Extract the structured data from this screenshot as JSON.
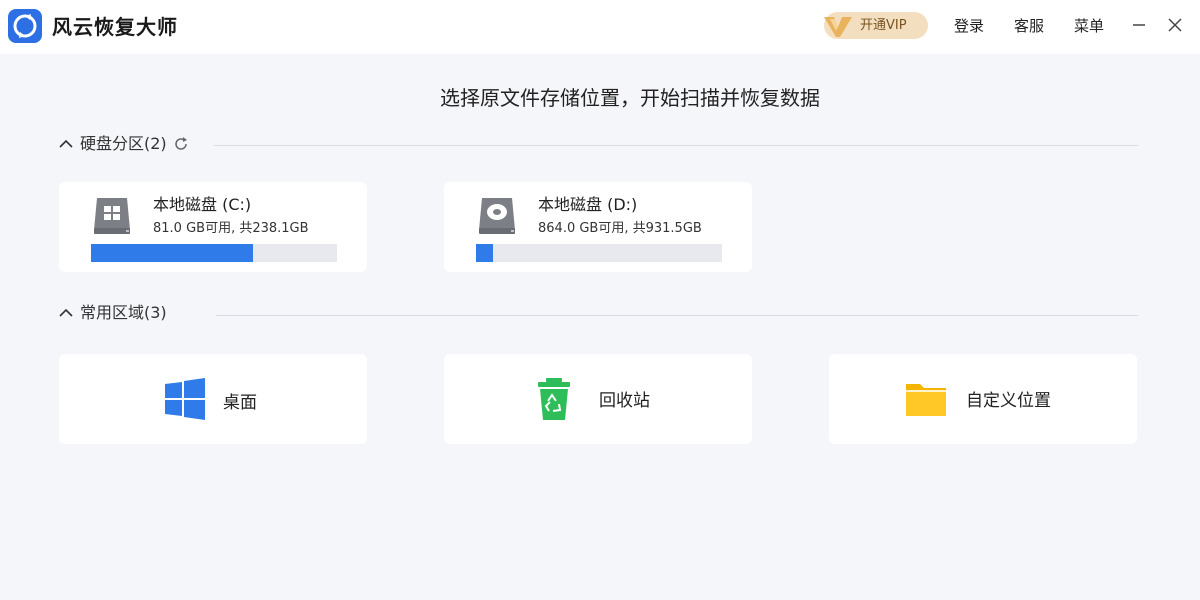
{
  "app": {
    "title": "风云恢复大师",
    "logo_icon": "recovery-logo-icon",
    "brand_color": "#2f6fe4"
  },
  "header": {
    "vip_label": "开通VIP",
    "login_label": "登录",
    "service_label": "客服",
    "menu_label": "菜单"
  },
  "main": {
    "heading": "选择原文件存储位置，开始扫描并恢复数据"
  },
  "drives_section": {
    "title": "硬盘分区(2)",
    "drives": [
      {
        "name": "本地磁盘 (C:)",
        "info": "81.0 GB可用, 共238.1GB",
        "used_fraction": 0.66,
        "icon": "windows-drive-icon"
      },
      {
        "name": "本地磁盘 (D:)",
        "info": "864.0 GB可用, 共931.5GB",
        "used_fraction": 0.07,
        "icon": "hard-drive-icon"
      }
    ]
  },
  "areas_section": {
    "title": "常用区域(3)",
    "areas": [
      {
        "label": "桌面",
        "icon": "windows-desktop-icon",
        "color": "#2f7be9"
      },
      {
        "label": "回收站",
        "icon": "recycle-bin-icon",
        "color": "#2ebd58"
      },
      {
        "label": "自定义位置",
        "icon": "folder-icon",
        "color": "#f5b400"
      }
    ]
  }
}
